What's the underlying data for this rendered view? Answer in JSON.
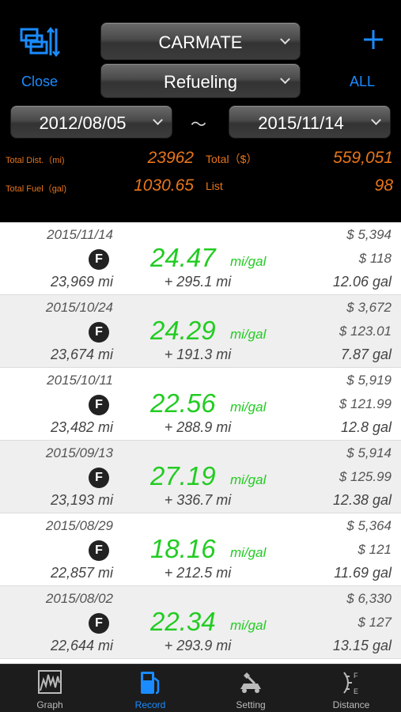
{
  "header": {
    "vehicle_select": "CARMATE",
    "record_type_select": "Refueling",
    "close_label": "Close",
    "all_label": "ALL",
    "start_date": "2012/08/05",
    "range_separator": "～",
    "end_date": "2015/11/14",
    "add_icon": "plus-icon",
    "sort_icon": "sort-icon"
  },
  "stats": {
    "total_dist_label": "Total Dist.（mi)",
    "total_dist_value": "23962",
    "total_cost_label": "Total（$）",
    "total_cost_value": "559,051",
    "total_fuel_label": "Total Fuel（gal)",
    "total_fuel_value": "1030.65",
    "list_label": "List",
    "list_value": "98"
  },
  "records": [
    {
      "date": "2015/11/14",
      "badge": "F",
      "odometer": "23,969 mi",
      "efficiency": "24.47",
      "unit": "mi/gal",
      "distance": "+ 295.1 mi",
      "price": "$ 5,394",
      "cost": "$ 118",
      "gallons": "12.06 gal"
    },
    {
      "date": "2015/10/24",
      "badge": "F",
      "odometer": "23,674 mi",
      "efficiency": "24.29",
      "unit": "mi/gal",
      "distance": "+ 191.3 mi",
      "price": "$ 3,672",
      "cost": "$ 123.01",
      "gallons": "7.87 gal"
    },
    {
      "date": "2015/10/11",
      "badge": "F",
      "odometer": "23,482 mi",
      "efficiency": "22.56",
      "unit": "mi/gal",
      "distance": "+ 288.9 mi",
      "price": "$ 5,919",
      "cost": "$ 121.99",
      "gallons": "12.8 gal"
    },
    {
      "date": "2015/09/13",
      "badge": "F",
      "odometer": "23,193 mi",
      "efficiency": "27.19",
      "unit": "mi/gal",
      "distance": "+ 336.7 mi",
      "price": "$ 5,914",
      "cost": "$ 125.99",
      "gallons": "12.38 gal"
    },
    {
      "date": "2015/08/29",
      "badge": "F",
      "odometer": "22,857 mi",
      "efficiency": "18.16",
      "unit": "mi/gal",
      "distance": "+ 212.5 mi",
      "price": "$ 5,364",
      "cost": "$ 121",
      "gallons": "11.69 gal"
    },
    {
      "date": "2015/08/02",
      "badge": "F",
      "odometer": "22,644 mi",
      "efficiency": "22.34",
      "unit": "mi/gal",
      "distance": "+ 293.9 mi",
      "price": "$ 6,330",
      "cost": "$ 127",
      "gallons": "13.15 gal"
    }
  ],
  "tabs": [
    {
      "label": "Graph",
      "icon": "graph-icon"
    },
    {
      "label": "Record",
      "icon": "fuel-pump-icon"
    },
    {
      "label": "Setting",
      "icon": "wrench-car-icon"
    },
    {
      "label": "Distance",
      "icon": "fuel-gauge-icon"
    }
  ],
  "colors": {
    "accent": "#1a8cff",
    "stats": "#e8751a",
    "efficiency": "#22cc22"
  }
}
